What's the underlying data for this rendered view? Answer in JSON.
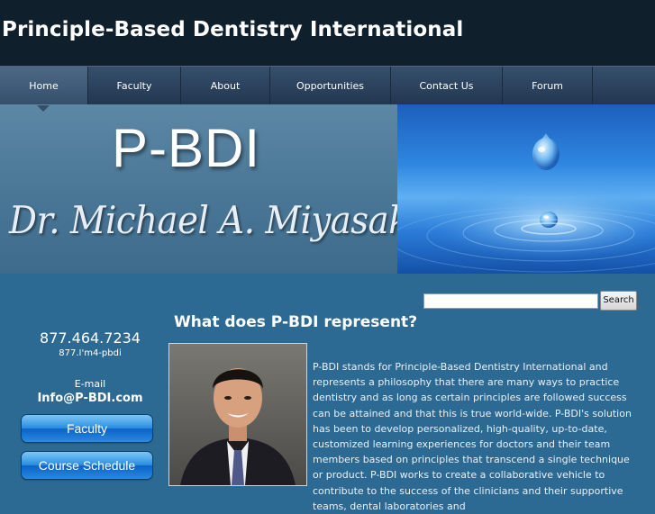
{
  "site": {
    "title": "Principle-Based Dentistry International"
  },
  "nav": {
    "items": [
      {
        "label": "Home"
      },
      {
        "label": "Faculty"
      },
      {
        "label": "About"
      },
      {
        "label": "Opportunities"
      },
      {
        "label": "Contact Us"
      },
      {
        "label": "Forum"
      }
    ],
    "active": "Home"
  },
  "banner": {
    "logo_text": "P-BDI",
    "name_script": "Dr. Michael A. Miyasaki"
  },
  "search": {
    "value": "",
    "button_label": "Search"
  },
  "sidebar": {
    "phone": "877.464.7234",
    "phone_alt": "877.I'm4-pbdi",
    "email_label": "E-mail",
    "email": "Info@P-BDI.com",
    "buttons": [
      {
        "label": "Faculty"
      },
      {
        "label": "Course Schedule"
      }
    ]
  },
  "content": {
    "heading": "What does P-BDI represent?",
    "paragraph": "P-BDI stands for Principle-Based Dentistry International and represents a philosophy that there are many ways to practice dentistry and as long as certain principles are followed success can be attained and that this is true world-wide.  P-BDI's solution has been to develop personalized, high-quality, up-to-date, customized learning experiences for doctors and their team members based on principles that transcend a single technique or product.  P-BDI works to create a collaborative vehicle to contribute to the success of the clinicians and their supportive teams, dental laboratories and"
  },
  "colors": {
    "page_bg": "#2d6a93",
    "header_bg": "#0f1f2c",
    "nav_bg": "#2a415b",
    "button_blue": "#1a78d6"
  }
}
